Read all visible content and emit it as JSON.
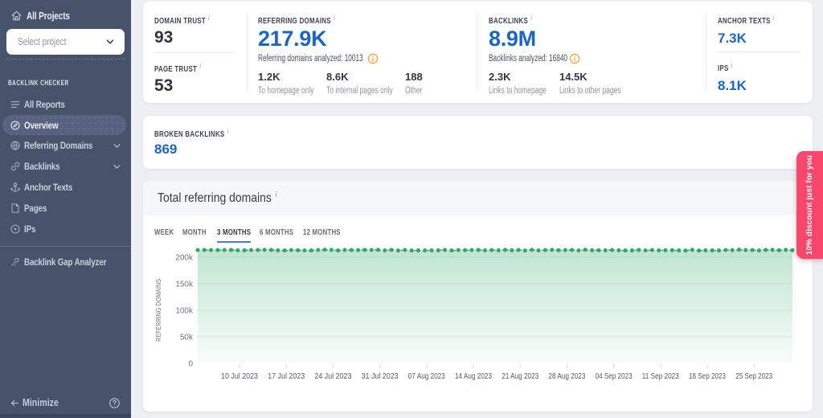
{
  "sidebar": {
    "all_projects_label": "All Projects",
    "select_placeholder": "Select project",
    "section_label": "BACKLINK CHECKER",
    "items": [
      {
        "label": "All Reports",
        "icon": "reports-icon",
        "active": false,
        "expandable": false
      },
      {
        "label": "Overview",
        "icon": "overview-icon",
        "active": true,
        "expandable": false
      },
      {
        "label": "Referring Domains",
        "icon": "globe-icon",
        "active": false,
        "expandable": true
      },
      {
        "label": "Backlinks",
        "icon": "link-icon",
        "active": false,
        "expandable": true
      },
      {
        "label": "Anchor Texts",
        "icon": "anchor-icon",
        "active": false,
        "expandable": false
      },
      {
        "label": "Pages",
        "icon": "page-icon",
        "active": false,
        "expandable": false
      },
      {
        "label": "IPs",
        "icon": "target-icon",
        "active": false,
        "expandable": false
      }
    ],
    "tools": [
      {
        "label": "Backlink Gap Analyzer",
        "icon": "gap-icon"
      }
    ],
    "minimize_label": "Minimize"
  },
  "metrics": {
    "domain_trust": {
      "label": "DOMAIN TRUST",
      "value": "93"
    },
    "page_trust": {
      "label": "PAGE TRUST",
      "value": "53"
    },
    "referring_domains": {
      "label": "REFERRING DOMAINS",
      "value": "217.9K",
      "analyzed": "Referring domains analyzed: 10013",
      "breakdown": [
        {
          "value": "1.2K",
          "label": "To homepage only"
        },
        {
          "value": "8.6K",
          "label": "To internal pages only"
        },
        {
          "value": "188",
          "label": "Other"
        }
      ]
    },
    "backlinks": {
      "label": "BACKLINKS",
      "value": "8.9M",
      "analyzed": "Backlinks analyzed: 16840",
      "breakdown": [
        {
          "value": "2.3K",
          "label": "Links to homepage"
        },
        {
          "value": "14.5K",
          "label": "Links to other pages"
        }
      ]
    },
    "anchor_texts": {
      "label": "ANCHOR TEXTS",
      "value": "7.3K"
    },
    "ips": {
      "label": "IPS",
      "value": "8.1K"
    },
    "broken_backlinks": {
      "label": "BROKEN BACKLINKS",
      "value": "869"
    }
  },
  "chart_section": {
    "title": "Total referring domains",
    "tabs": [
      {
        "label": "WEEK",
        "active": false
      },
      {
        "label": "MONTH",
        "active": false
      },
      {
        "label": "3 MONTHS",
        "active": true
      },
      {
        "label": "6 MONTHS",
        "active": false
      },
      {
        "label": "12 MONTHS",
        "active": false
      }
    ]
  },
  "chart_data": {
    "type": "area",
    "title": "Total referring domains",
    "ylabel": "REFERRING DOMAINS",
    "ylim": [
      0,
      200000
    ],
    "ytick_labels": [
      "0",
      "50k",
      "100k",
      "150k",
      "200k"
    ],
    "ytick_values": [
      0,
      50000,
      100000,
      150000,
      200000
    ],
    "x_labels": [
      "10 Jul 2023",
      "17 Jul 2023",
      "24 Jul 2023",
      "31 Jul 2023",
      "07 Aug 2023",
      "14 Aug 2023",
      "21 Aug 2023",
      "28 Aug 2023",
      "04 Sep 2023",
      "11 Sep 2023",
      "18 Sep 2023",
      "25 Sep 2023"
    ],
    "grid": true,
    "legend_position": "none",
    "series": [
      {
        "name": "Referring domains",
        "values": [
          213526,
          213746,
          213553,
          213525,
          213640,
          213802,
          212988,
          212978,
          213648,
          213574,
          213889,
          213857,
          212981,
          212792,
          213514,
          213221,
          212890,
          212785,
          213703,
          214020,
          213899,
          212685,
          213819,
          213411,
          213527,
          213939,
          213860,
          213931,
          212922,
          213876,
          212630,
          213682,
          212729,
          212721,
          212673,
          212989,
          213095,
          213828,
          212661,
          213550,
          213268,
          213502,
          213810,
          213000,
          213663,
          213078,
          213911,
          213202,
          213623,
          212609,
          213956,
          212774,
          213536,
          213941,
          213169,
          213433,
          213728,
          212770,
          214049,
          213120,
          213245,
          213070,
          213650,
          213191,
          212660,
          212743,
          213753,
          212821,
          213420,
          212820,
          213195,
          213391,
          212736,
          212634,
          214002,
          212601,
          213037,
          213029,
          212707,
          213562,
          213368,
          214051,
          213413,
          213459,
          212749,
          213759,
          213889,
          213006,
          213982,
          213152
        ]
      }
    ]
  },
  "ribbon": {
    "text": "10% discount just for you",
    "color": "#f8476b"
  },
  "colors": {
    "accent_blue": "#1b64c9",
    "green": "#2fa869",
    "orange": "#f0a231",
    "sidebar_bg": "#47526b",
    "ribbon_pink": "#f8476b"
  }
}
